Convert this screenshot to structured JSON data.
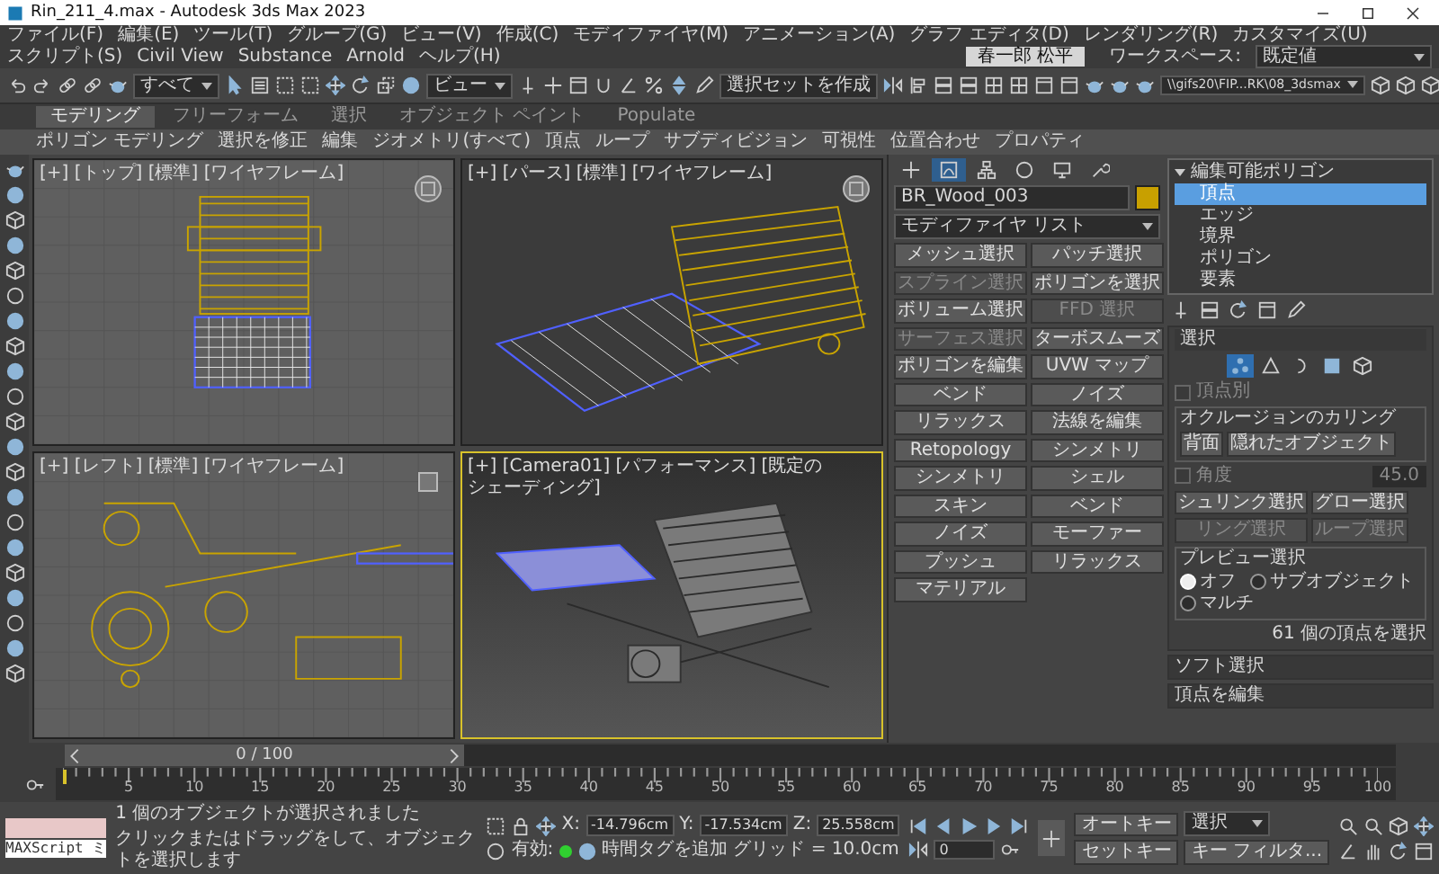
{
  "window": {
    "title": "Rin_211_4.max - Autodesk 3ds Max 2023"
  },
  "menu": [
    "ファイル(F)",
    "編集(E)",
    "ツール(T)",
    "グループ(G)",
    "ビュー(V)",
    "作成(C)",
    "モディファイヤ(M)",
    "アニメーション(A)",
    "グラフ エディタ(D)",
    "レンダリング(R)",
    "カスタマイズ(U)",
    "スクリプト(S)",
    "Civil View",
    "Substance",
    "Arnold",
    "ヘルプ(H)"
  ],
  "account": {
    "user": "春一郎 松平",
    "workspace_label": "ワークスペース:",
    "workspace": "既定値"
  },
  "toolbar": {
    "selection_filter": "すべて",
    "coordinate_system": "ビュー",
    "named_selection_set": "選択セットを作成",
    "project_folder": "\\\\gifs20\\FIP...RK\\08_3dsmax"
  },
  "ribbon": {
    "tabs": [
      {
        "label": "モデリング",
        "selected": true
      },
      {
        "label": "フリーフォーム",
        "selected": false
      },
      {
        "label": "選択",
        "selected": false
      },
      {
        "label": "オブジェクト ペイント",
        "selected": false
      },
      {
        "label": "Populate",
        "selected": false
      }
    ],
    "panels": [
      "ポリゴン モデリング",
      "選択を修正",
      "編集",
      "ジオメトリ(すべて)",
      "頂点",
      "ループ",
      "サブディビジョン",
      "可視性",
      "位置合わせ",
      "プロパティ"
    ]
  },
  "viewports": [
    {
      "kind": "top",
      "label": "[+] [トップ] [標準] [ワイヤフレーム]",
      "active": false
    },
    {
      "kind": "perspective",
      "label": "[+] [パース] [標準] [ワイヤフレーム]",
      "active": false
    },
    {
      "kind": "left",
      "label": "[+] [レフト] [標準] [ワイヤフレーム]",
      "active": false
    },
    {
      "kind": "camera",
      "label": "[+] [Camera01] [パフォーマンス] [既定のシェーディング]",
      "active": true
    }
  ],
  "command_panel": {
    "tabs": [
      {
        "selected": false
      },
      {
        "selected": true
      },
      {
        "selected": false
      },
      {
        "selected": false
      },
      {
        "selected": false
      },
      {
        "selected": false
      }
    ],
    "object_name": "BR_Wood_003",
    "modifier_list": "モディファイヤ リスト",
    "modifier_buttons": [
      {
        "label": "メッシュ選択",
        "disabled": false
      },
      {
        "label": "パッチ選択",
        "disabled": false
      },
      {
        "label": "スプライン選択",
        "disabled": true
      },
      {
        "label": "ポリゴンを選択",
        "disabled": false
      },
      {
        "label": "ボリューム選択",
        "disabled": false
      },
      {
        "label": "FFD 選択",
        "disabled": true
      },
      {
        "label": "サーフェス選択",
        "disabled": true
      },
      {
        "label": "ターボスムーズ",
        "disabled": false
      },
      {
        "label": "ポリゴンを編集",
        "disabled": false
      },
      {
        "label": "UVW マップ",
        "disabled": false
      },
      {
        "label": "ベンド",
        "disabled": false
      },
      {
        "label": "ノイズ",
        "disabled": false
      },
      {
        "label": "リラックス",
        "disabled": false
      },
      {
        "label": "法線を編集",
        "disabled": false
      },
      {
        "label": "Retopology",
        "disabled": false
      },
      {
        "label": "シンメトリ",
        "disabled": false
      },
      {
        "label": "シンメトリ",
        "disabled": false
      },
      {
        "label": "シェル",
        "disabled": false
      },
      {
        "label": "スキン",
        "disabled": false
      },
      {
        "label": "ベンド",
        "disabled": false
      },
      {
        "label": "ノイズ",
        "disabled": false
      },
      {
        "label": "モーファー",
        "disabled": false
      },
      {
        "label": "プッシュ",
        "disabled": false
      },
      {
        "label": "リラックス",
        "disabled": false
      },
      {
        "label": "マテリアル",
        "disabled": false
      }
    ],
    "stack": [
      {
        "label": "編集可能ポリゴン",
        "expanded": true,
        "children": [
          {
            "label": "頂点",
            "selected": true
          },
          {
            "label": "エッジ",
            "selected": false
          },
          {
            "label": "境界",
            "selected": false
          },
          {
            "label": "ポリゴン",
            "selected": false
          },
          {
            "label": "要素",
            "selected": false
          }
        ]
      }
    ],
    "selection": {
      "title": "選択",
      "levels": [
        {
          "selected": true
        },
        {
          "selected": false
        },
        {
          "selected": false
        },
        {
          "selected": false
        },
        {
          "selected": false
        }
      ],
      "by_vertex": {
        "label": "頂点別",
        "checked": false,
        "disabled": true
      },
      "occlusion_title": "オクルージョンのカリング",
      "occlusion_buttons": [
        "背面",
        "隠れたオブジェクト"
      ],
      "angle": {
        "label": "角度",
        "value": "45.0",
        "disabled": true
      },
      "buttons": [
        {
          "label": "シュリンク選択",
          "disabled": false
        },
        {
          "label": "グロー選択",
          "disabled": false
        },
        {
          "label": "リング選択",
          "disabled": true
        },
        {
          "label": "ループ選択",
          "disabled": true
        }
      ],
      "preview_title": "プレビュー選択",
      "preview_options": [
        {
          "label": "オフ",
          "selected": true
        },
        {
          "label": "サブオブジェクト",
          "selected": false
        },
        {
          "label": "マルチ",
          "selected": false
        }
      ],
      "status": "61 個の頂点を選択"
    },
    "collapsed_rollouts": [
      "ソフト選択",
      "頂点を編集"
    ]
  },
  "time_slider": {
    "frame": "0 / 100",
    "level": 0
  },
  "track_bar": {
    "labels": [
      "5",
      "10",
      "15",
      "20",
      "25",
      "30",
      "35",
      "40",
      "45",
      "50",
      "55",
      "60",
      "65",
      "70",
      "75",
      "80",
      "85",
      "90",
      "95",
      "100"
    ]
  },
  "status_bar": {
    "maxscript": "MAXScript ミ",
    "messages": [
      "1 個のオブジェクトが選択されました",
      "クリックまたはドラッグをして、オブジェクトを選択します"
    ],
    "coordinates": [
      {
        "axis": "X:",
        "value": "-14.796cm"
      },
      {
        "axis": "Y:",
        "value": "-17.534cm"
      },
      {
        "axis": "Z:",
        "value": "25.558cm"
      }
    ],
    "grid": "グリッド = 10.0cm",
    "enabled": {
      "label": "有効:",
      "on": true
    },
    "add_time_tag": "時間タグを追加",
    "current_frame": "0",
    "auto_key": "オートキー",
    "set_key": "セットキー",
    "key_set": "選択",
    "key_filters": "キー フィルタ..."
  }
}
